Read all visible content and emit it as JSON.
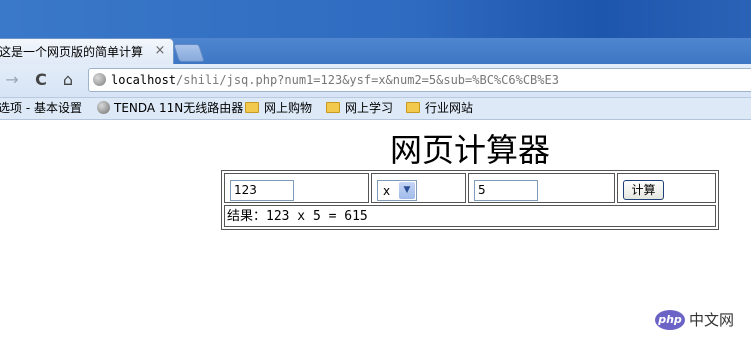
{
  "browser": {
    "tab": {
      "title": "这是一个网页版的简单计算",
      "close": "×"
    },
    "nav": {
      "forward": "→",
      "reload": "C",
      "home": "⌂"
    },
    "url": {
      "host": "localhost",
      "path": "/shili/jsq.php?num1=123&ysf=x&num2=5&sub=%BC%C6%CB%E3"
    },
    "bookmarks": [
      {
        "label": "选项 - 基本设置",
        "icon": "none"
      },
      {
        "label": "TENDA 11N无线路由器",
        "icon": "globe-icon"
      },
      {
        "label": "网上购物",
        "icon": "folder-icon"
      },
      {
        "label": "网上学习",
        "icon": "folder-icon"
      },
      {
        "label": "行业网站",
        "icon": "folder-icon"
      }
    ]
  },
  "page": {
    "title": "网页计算器",
    "form": {
      "num1": "123",
      "operator": "x",
      "num2": "5",
      "submit_label": "计算"
    },
    "result": "结果：123 x 5 = 615"
  },
  "watermark": {
    "logo": "php",
    "text": "中文网"
  },
  "colors": {
    "chrome_blue": "#3a78c9",
    "toolbar": "#dde9f7",
    "border": "#555555"
  }
}
